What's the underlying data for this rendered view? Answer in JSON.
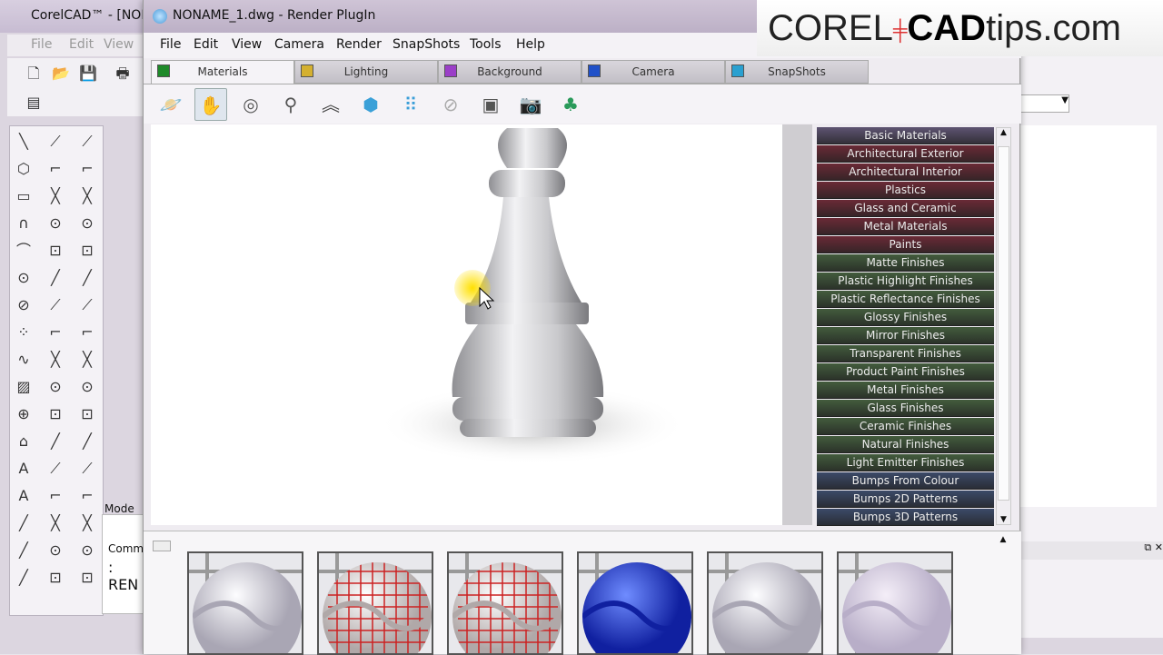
{
  "background_app": {
    "title": "CorelCAD™ - [NON",
    "menu": [
      "File",
      "Edit",
      "View"
    ],
    "layout_tab": "Mode",
    "command_label": "Comm",
    "command_text": ": REN"
  },
  "window": {
    "title": "NONAME_1.dwg - Render PlugIn"
  },
  "menu": [
    "File",
    "Edit",
    "View",
    "Camera",
    "Render",
    "SnapShots",
    "Tools",
    "Help"
  ],
  "tabs": [
    {
      "label": "Materials",
      "color": "#1f8a2a",
      "active": true
    },
    {
      "label": "Lighting",
      "color": "#d4b030"
    },
    {
      "label": "Background",
      "color": "#9b3fc8"
    },
    {
      "label": "Camera",
      "color": "#2050c8"
    },
    {
      "label": "SnapShots",
      "color": "#2aa0d0"
    }
  ],
  "toolbar_icons": [
    "planet-icon",
    "hand-icon",
    "camera-lens-icon",
    "spotlight-icon",
    "chevron-up-icon",
    "cube-icon",
    "grid-icon",
    "disabled-icon",
    "frame-icon",
    "photo-camera-icon",
    "clover-icon"
  ],
  "material_categories": [
    {
      "label": "Basic Materials",
      "group": "basic"
    },
    {
      "label": "Architectural Exterior",
      "group": "arch"
    },
    {
      "label": "Architectural Interior",
      "group": "arch"
    },
    {
      "label": "Plastics",
      "group": "arch"
    },
    {
      "label": "Glass and Ceramic",
      "group": "arch"
    },
    {
      "label": "Metal Materials",
      "group": "arch"
    },
    {
      "label": "Paints",
      "group": "arch"
    },
    {
      "label": "Matte Finishes",
      "group": "finish"
    },
    {
      "label": "Plastic Highlight Finishes",
      "group": "finish"
    },
    {
      "label": "Plastic Reflectance Finishes",
      "group": "finish"
    },
    {
      "label": "Glossy Finishes",
      "group": "finish"
    },
    {
      "label": "Mirror Finishes",
      "group": "finish"
    },
    {
      "label": "Transparent Finishes",
      "group": "finish"
    },
    {
      "label": "Product Paint Finishes",
      "group": "finish"
    },
    {
      "label": "Metal Finishes",
      "group": "finish"
    },
    {
      "label": "Glass Finishes",
      "group": "finish"
    },
    {
      "label": "Ceramic Finishes",
      "group": "finish"
    },
    {
      "label": "Natural Finishes",
      "group": "finish"
    },
    {
      "label": "Light Emitter Finishes",
      "group": "finish"
    },
    {
      "label": "Bumps From Colour",
      "group": "bump"
    },
    {
      "label": "Bumps 2D Patterns",
      "group": "bump"
    },
    {
      "label": "Bumps 3D Patterns",
      "group": "bump"
    }
  ],
  "group_colors": {
    "basic": "#5e5472",
    "arch": "#6a2a36",
    "finish": "#435c3d",
    "bump": "#3c4a68"
  },
  "thumbnails": [
    {
      "style": "white"
    },
    {
      "style": "red-grid"
    },
    {
      "style": "red-grid"
    },
    {
      "style": "blue"
    },
    {
      "style": "white"
    },
    {
      "style": "pearl"
    }
  ],
  "logo": {
    "prefix": "COREL",
    "bold": "CAD",
    "suffix": "tips.com"
  }
}
